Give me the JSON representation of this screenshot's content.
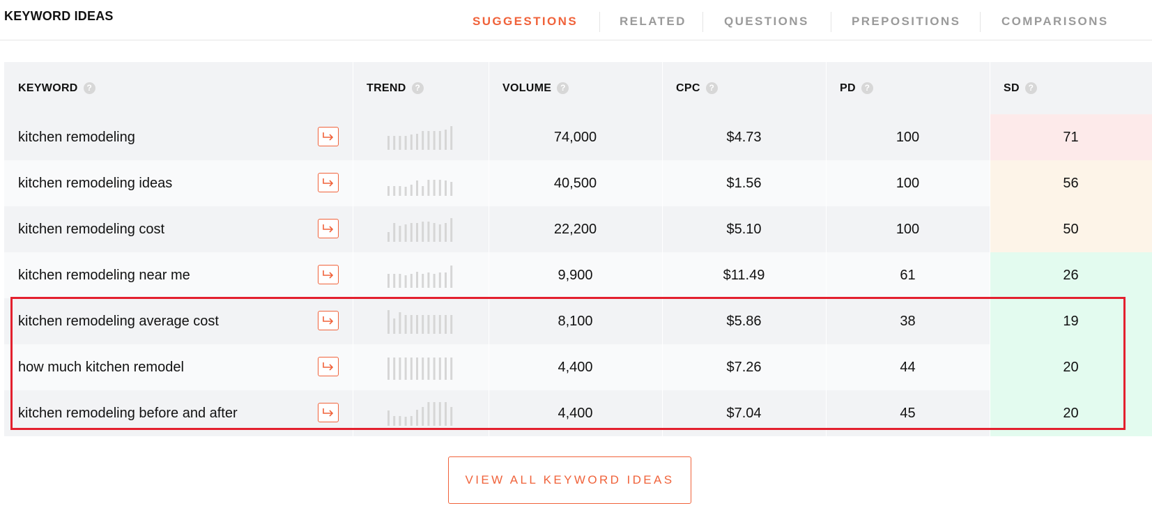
{
  "panel_title": "KEYWORD IDEAS",
  "tabs": [
    "SUGGESTIONS",
    "RELATED",
    "QUESTIONS",
    "PREPOSITIONS",
    "COMPARISONS"
  ],
  "active_tab": "SUGGESTIONS",
  "columns": {
    "keyword": "KEYWORD",
    "trend": "TREND",
    "volume": "VOLUME",
    "cpc": "CPC",
    "pd": "PD",
    "sd": "SD",
    "help": "?"
  },
  "rows": [
    {
      "keyword": "kitchen remodeling",
      "volume": "74,000",
      "cpc": "$4.73",
      "pd": "100",
      "sd": "71",
      "trend": [
        0.55,
        0.55,
        0.55,
        0.55,
        0.6,
        0.65,
        0.75,
        0.75,
        0.75,
        0.75,
        0.8,
        0.95
      ]
    },
    {
      "keyword": "kitchen remodeling ideas",
      "volume": "40,500",
      "cpc": "$1.56",
      "pd": "100",
      "sd": "56",
      "trend": [
        0.4,
        0.4,
        0.4,
        0.35,
        0.45,
        0.6,
        0.4,
        0.65,
        0.65,
        0.65,
        0.6,
        0.55
      ]
    },
    {
      "keyword": "kitchen remodeling cost",
      "volume": "22,200",
      "cpc": "$5.10",
      "pd": "100",
      "sd": "50",
      "trend": [
        0.4,
        0.75,
        0.65,
        0.7,
        0.75,
        0.75,
        0.8,
        0.8,
        0.75,
        0.7,
        0.75,
        0.95
      ]
    },
    {
      "keyword": "kitchen remodeling near me",
      "volume": "9,900",
      "cpc": "$11.49",
      "pd": "61",
      "sd": "26",
      "trend": [
        0.55,
        0.55,
        0.55,
        0.5,
        0.55,
        0.65,
        0.55,
        0.6,
        0.55,
        0.6,
        0.6,
        0.9
      ]
    },
    {
      "keyword": "kitchen remodeling average cost",
      "volume": "8,100",
      "cpc": "$5.86",
      "pd": "38",
      "sd": "19",
      "trend": [
        0.95,
        0.6,
        0.85,
        0.75,
        0.75,
        0.75,
        0.75,
        0.75,
        0.75,
        0.75,
        0.75,
        0.75
      ]
    },
    {
      "keyword": "how much kitchen remodel",
      "volume": "4,400",
      "cpc": "$7.26",
      "pd": "44",
      "sd": "20",
      "trend": [
        0.9,
        0.9,
        0.9,
        0.9,
        0.9,
        0.9,
        0.9,
        0.9,
        0.9,
        0.9,
        0.9,
        0.9
      ]
    },
    {
      "keyword": "kitchen remodeling before and after",
      "volume": "4,400",
      "cpc": "$7.04",
      "pd": "45",
      "sd": "20",
      "trend": [
        0.6,
        0.4,
        0.4,
        0.35,
        0.4,
        0.65,
        0.75,
        0.95,
        0.95,
        0.95,
        0.95,
        0.75
      ]
    }
  ],
  "sd_colors": [
    "#fdeaea",
    "#fdf4e8",
    "#fdf4e8",
    "#e3fbef",
    "#e3fbef",
    "#e3fbef",
    "#e3fbef"
  ],
  "row_colors": [
    "#f2f3f5",
    "#f9fafb",
    "#f2f3f5",
    "#f9fafb",
    "#f2f3f5",
    "#f9fafb",
    "#f2f3f5"
  ],
  "accent_color": "#f0623a",
  "highlight_color": "#e3202e",
  "view_all_label": "VIEW ALL KEYWORD IDEAS"
}
